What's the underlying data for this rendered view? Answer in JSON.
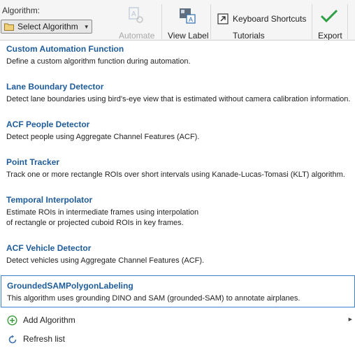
{
  "toolbar": {
    "algorithm_label": "Algorithm:",
    "select_label": "Select Algorithm",
    "automate_label": "Automate",
    "view_label_label": "View Label",
    "keyboard_shortcuts_label": "Keyboard Shortcuts",
    "tutorials_label": "Tutorials",
    "export_label": "Export",
    "icons": {
      "select": "folder-icon",
      "dropdown": "chevron-down-icon",
      "automate": "automate-icon",
      "view_label": "view-label-icon",
      "keyboard_shortcuts": "keyboard-shortcut-arrow-icon",
      "export": "checkmark-icon"
    },
    "colors": {
      "export_check": "#2ea043",
      "disabled_text": "#a8a8a8"
    }
  },
  "menu": {
    "items": [
      {
        "title": "Custom Automation Function",
        "description": "Define a custom algorithm function during automation."
      },
      {
        "title": "Lane Boundary Detector",
        "description": "Detect lane boundaries using bird's-eye view that is estimated without camera calibration information."
      },
      {
        "title": "ACF People Detector",
        "description": "Detect people using Aggregate Channel Features (ACF)."
      },
      {
        "title": "Point Tracker",
        "description": "Track one or more rectangle ROIs over short intervals using Kanade-Lucas-Tomasi (KLT) algorithm."
      },
      {
        "title": "Temporal Interpolator",
        "description_line1": "Estimate ROIs in intermediate frames using interpolation",
        "description_line2": "of rectangle or projected cuboid ROIs in key frames."
      },
      {
        "title": "ACF Vehicle Detector",
        "description": "Detect vehicles using Aggregate Channel Features (ACF)."
      },
      {
        "title": "GroundedSAMPolygonLabeling",
        "description": "This algorithm uses grounding DINO and SAM (grounded-SAM) to annotate airplanes.",
        "selected": true
      }
    ],
    "footer": {
      "add_algorithm": "Add Algorithm",
      "refresh_list": "Refresh list",
      "icons": {
        "add": "add-circle-icon",
        "refresh": "refresh-icon",
        "submenu": "chevron-right-icon"
      }
    },
    "colors": {
      "title": "#1e5c9b",
      "selection_border": "#3a7fd0",
      "add_icon": "#3a9a3a"
    }
  }
}
